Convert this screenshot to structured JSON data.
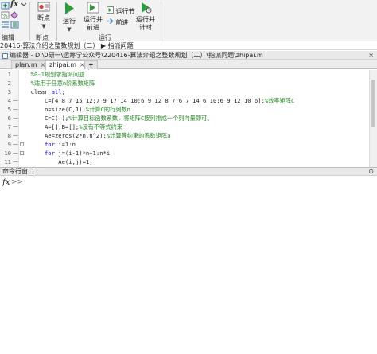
{
  "ribbon": {
    "groups": [
      {
        "label": "编辑"
      },
      {
        "label": "断点"
      },
      {
        "label": "运行"
      }
    ],
    "breakpoints_label": "断点",
    "run_label": "运行",
    "run_advance_label": "运行并\n前进",
    "run_section_label": "运行节",
    "advance_label": "前进",
    "run_time_label": "运行并\n计时"
  },
  "breadcrumb": "20416-算法介绍之整数规划（二） ▶ 指派问题",
  "editor_header": "编辑器 - D:\\0研一\\运筹学公众号\\220416-算法介绍之整数规划（二）\\指派问题\\zhipai.m",
  "tabs": [
    {
      "label": "plan.m",
      "active": false
    },
    {
      "label": "zhipai.m",
      "active": true
    },
    {
      "label": "+",
      "active": false
    }
  ],
  "code_lines": [
    {
      "n": "1",
      "dash": "",
      "html_parts": [
        {
          "t": "  %0-1规划求指派问题",
          "c": "cm"
        }
      ]
    },
    {
      "n": "2",
      "dash": "",
      "html_parts": [
        {
          "t": "  %适用于任意n阶系数矩阵",
          "c": "cm"
        }
      ]
    },
    {
      "n": "3",
      "dash": "",
      "html_parts": [
        {
          "t": "  clear ",
          "c": ""
        },
        {
          "t": "all",
          "c": "kw"
        },
        {
          "t": ";",
          "c": ""
        }
      ]
    },
    {
      "n": "4",
      "dash": "—",
      "html_parts": [
        {
          "t": "      C=[4 8 7 15 12;7 9 17 14 10;6 9 12 8 7;6 7 14 6 10;6 9 12 10 6];",
          "c": ""
        },
        {
          "t": "%效率矩阵C",
          "c": "cm"
        }
      ]
    },
    {
      "n": "5",
      "dash": "—",
      "html_parts": [
        {
          "t": "      n=size(C,1);",
          "c": ""
        },
        {
          "t": "%计算C的行列数n",
          "c": "cm"
        }
      ]
    },
    {
      "n": "6",
      "dash": "—",
      "html_parts": [
        {
          "t": "      C=C(:);",
          "c": ""
        },
        {
          "t": "%计算目标函数系数，将矩阵C按列排成一个列向量即可。",
          "c": "cm"
        }
      ]
    },
    {
      "n": "7",
      "dash": "—",
      "html_parts": [
        {
          "t": "      A=[];B=[];",
          "c": ""
        },
        {
          "t": "%没有不等式约束",
          "c": "cm"
        }
      ]
    },
    {
      "n": "8",
      "dash": "—",
      "html_parts": [
        {
          "t": "      Ae=zeros(2*n,n^2);",
          "c": ""
        },
        {
          "t": "%计算等约束的系数矩阵a",
          "c": "cm"
        }
      ]
    },
    {
      "n": "9",
      "dash": "—",
      "html_parts": [
        {
          "t": "      ",
          "c": ""
        },
        {
          "t": "for",
          "c": "kw"
        },
        {
          "t": " i=1:n",
          "c": ""
        }
      ]
    },
    {
      "n": "10",
      "dash": "—",
      "html_parts": [
        {
          "t": "      ",
          "c": ""
        },
        {
          "t": "for",
          "c": "kw"
        },
        {
          "t": " j=(i-1)*n+1:n*i",
          "c": ""
        }
      ]
    },
    {
      "n": "11",
      "dash": "—",
      "html_parts": [
        {
          "t": "          Ae(i,j)=1;",
          "c": ""
        }
      ]
    }
  ],
  "command_window": {
    "title": "命令行窗口",
    "prompt_icon": "fx",
    "prompt_chevrons": ">>"
  },
  "colors": {
    "keyword": "#0000ff",
    "comment": "#228b22",
    "run_green": "#2e9b3a"
  }
}
